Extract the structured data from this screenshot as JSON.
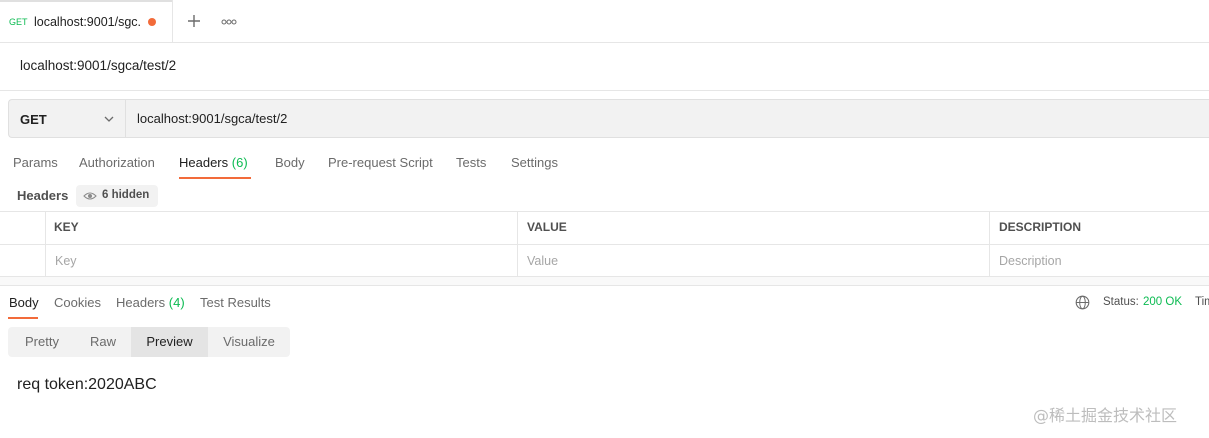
{
  "tab": {
    "method": "GET",
    "title": "localhost:9001/sgc..."
  },
  "request": {
    "name": "localhost:9001/sgca/test/2",
    "method": "GET",
    "url": "localhost:9001/sgca/test/2"
  },
  "request_tabs": [
    {
      "label": "Params",
      "count": ""
    },
    {
      "label": "Authorization",
      "count": ""
    },
    {
      "label": "Headers",
      "count": "(6)"
    },
    {
      "label": "Body",
      "count": ""
    },
    {
      "label": "Pre-request Script",
      "count": ""
    },
    {
      "label": "Tests",
      "count": ""
    },
    {
      "label": "Settings",
      "count": ""
    }
  ],
  "headers_section": {
    "label": "Headers",
    "hidden": "6 hidden",
    "columns": [
      "KEY",
      "VALUE",
      "DESCRIPTION"
    ],
    "placeholders": {
      "key": "Key",
      "value": "Value",
      "description": "Description"
    }
  },
  "response_tabs": [
    {
      "label": "Body",
      "count": ""
    },
    {
      "label": "Cookies",
      "count": ""
    },
    {
      "label": "Headers",
      "count": "(4)"
    },
    {
      "label": "Test Results",
      "count": ""
    }
  ],
  "status": {
    "label": "Status:",
    "value": "200 OK",
    "time_label": "Tim"
  },
  "formats": [
    "Pretty",
    "Raw",
    "Preview",
    "Visualize"
  ],
  "response_body": "req token:2020ABC",
  "watermark": "@稀土掘金技术社区",
  "colors": {
    "accent": "#f26b3a",
    "success": "#0cbb52",
    "bar_bg": "#f2f2f2"
  }
}
